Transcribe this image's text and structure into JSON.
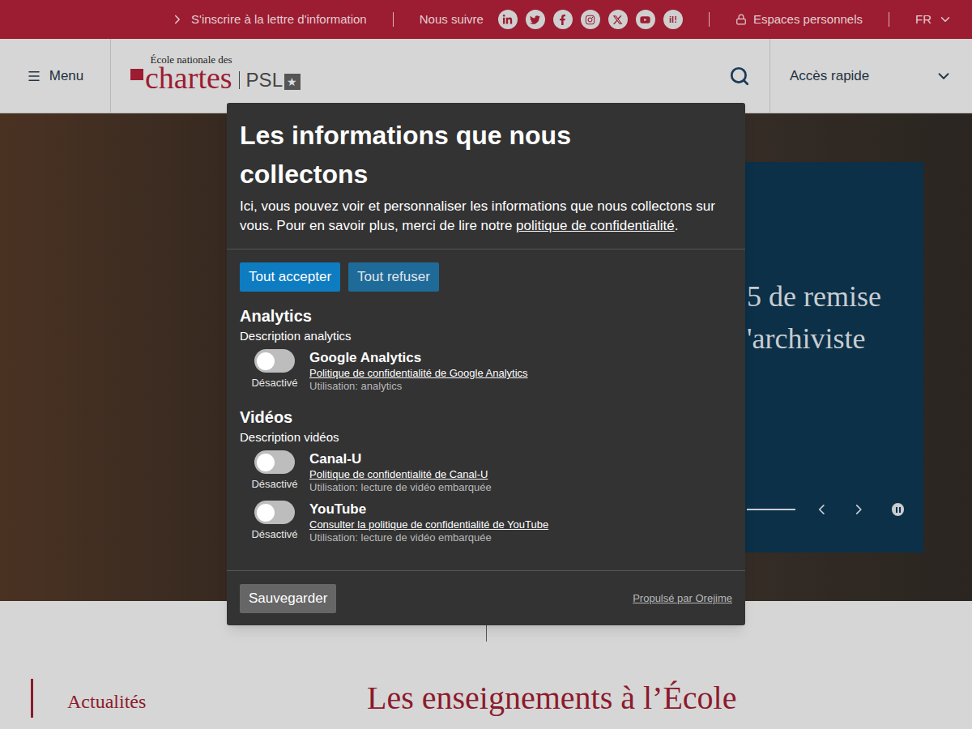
{
  "topbar": {
    "newsletter": "S'inscrire à la lettre d'information",
    "follow": "Nous suivre",
    "hypotheses_glyph": "il!",
    "personal": "Espaces personnels",
    "language": "FR"
  },
  "header": {
    "menu": "Menu",
    "logo": {
      "small": "École nationale des",
      "main": "chartes",
      "partner": "PSL",
      "star": "★"
    },
    "quick_access": "Accès rapide"
  },
  "hero": {
    "panel_lines": [
      "5 de remise",
      "'archiviste"
    ]
  },
  "cookie_modal": {
    "title": "Les informations que nous collectons",
    "description_before": "Ici, vous pouvez voir et personnaliser les informations que nous collectons sur vous. Pour en savoir plus, merci de lire notre ",
    "privacy_link": "politique de confidentialité",
    "description_after": ".",
    "accept_all": "Tout accepter",
    "refuse_all": "Tout refuser",
    "purposes": [
      {
        "title": "Analytics",
        "description": "Description analytics",
        "apps": [
          {
            "name": "Google Analytics",
            "policy": "Politique de confidentialité de Google Analytics",
            "usage": "Utilisation: analytics",
            "on": false,
            "state_label": "Désactivé"
          }
        ]
      },
      {
        "title": "Vidéos",
        "description": "Description vidéos",
        "apps": [
          {
            "name": "Canal-U",
            "policy": "Politique de confidentialité de Canal-U",
            "usage": "Utilisation: lecture de vidéo embarquée",
            "on": false,
            "state_label": "Désactivé"
          },
          {
            "name": "YouTube",
            "policy": "Consulter la politique de confidentialité de YouTube",
            "usage": "Utilisation: lecture de vidéo embarquée",
            "on": false,
            "state_label": "Désactivé"
          }
        ]
      }
    ],
    "save": "Sauvegarder",
    "powered_by": "Propulsé par Orejime"
  },
  "page": {
    "news_heading": "Actualités",
    "section_heading": "Les enseignements à l’École"
  }
}
